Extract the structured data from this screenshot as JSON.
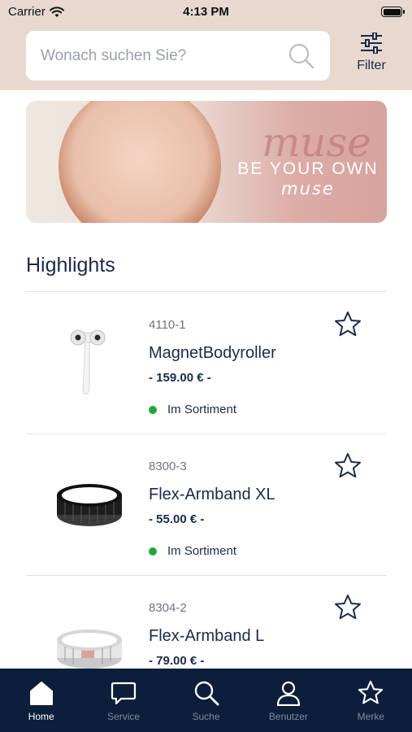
{
  "status_bar": {
    "carrier": "Carrier",
    "time": "4:13 PM"
  },
  "search": {
    "placeholder": "Wonach suchen Sie?"
  },
  "filter": {
    "label": "Filter"
  },
  "banner": {
    "brand": "muse",
    "headline": "BE YOUR OWN",
    "subline": "muse"
  },
  "section": {
    "title": "Highlights"
  },
  "products": [
    {
      "sku": "4110-1",
      "name": "MagnetBodyroller",
      "price": "- 159.00 € -",
      "status": "Im Sortiment",
      "image": "bodyroller-image"
    },
    {
      "sku": "8300-3",
      "name": "Flex-Armband XL",
      "price": "- 55.00 € -",
      "status": "Im Sortiment",
      "image": "black-bracelet-image"
    },
    {
      "sku": "8304-2",
      "name": "Flex-Armband L",
      "price": "- 79.00 € -",
      "status": "",
      "image": "silver-bracelet-image"
    }
  ],
  "tabbar": {
    "tabs": [
      {
        "label": "Home",
        "icon": "home-icon",
        "active": true
      },
      {
        "label": "Service",
        "icon": "chat-bubble-icon",
        "active": false
      },
      {
        "label": "Suche",
        "icon": "search-icon",
        "active": false
      },
      {
        "label": "Benutzer",
        "icon": "user-icon",
        "active": false
      },
      {
        "label": "Merke",
        "icon": "star-icon",
        "active": false
      }
    ]
  },
  "colors": {
    "header_bg": "#e8d8cf",
    "navy": "#1c2a4a",
    "tabbar_bg": "#0d1e3b",
    "in_stock": "#1ea83a"
  }
}
